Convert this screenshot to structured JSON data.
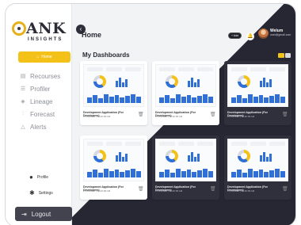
{
  "brand": {
    "wordmark": "ANK",
    "subtitle": "INSIGHTS"
  },
  "header": {
    "title": "Home",
    "add_label": "+ Add",
    "user_name": "Welum",
    "user_email": "user@gmail.com"
  },
  "sidebar": {
    "home_label": "Home",
    "items": [
      {
        "label": "Recourses",
        "icon": "document-icon"
      },
      {
        "label": "Profiler",
        "icon": "profile-list-icon"
      },
      {
        "label": "Lineage",
        "icon": "lineage-icon"
      },
      {
        "label": "Forecast",
        "icon": "chart-icon"
      },
      {
        "label": "Alerts",
        "icon": "alert-triangle-icon"
      }
    ],
    "profile_label": "Profile",
    "settings_label": "Settings",
    "logout_label": "Logout"
  },
  "main": {
    "section_title": "My Dashboards",
    "cards": [
      {
        "title": "Development Application (For Developers)",
        "meta": "17/05/2023 | 10:30:58 AM"
      },
      {
        "title": "Development Application (For Developers)",
        "meta": "17/05/2023 | 10:30:58 AM"
      },
      {
        "title": "Development Application (For Developers)",
        "meta": "17/05/2023 | 10:30:58 AM"
      },
      {
        "title": "Development Application (For Developers)",
        "meta": "17/05/2023 | 10:30:58 AM"
      },
      {
        "title": "Development Application (For Developers)",
        "meta": "17/05/2023 | 10:30:58 AM"
      },
      {
        "title": "Development Application (For Developers)",
        "meta": "17/05/2023 | 10:30:58 AM"
      }
    ]
  },
  "colors": {
    "accent": "#f4c118",
    "dark": "#262733",
    "chart_blue": "#2f6fd6"
  }
}
